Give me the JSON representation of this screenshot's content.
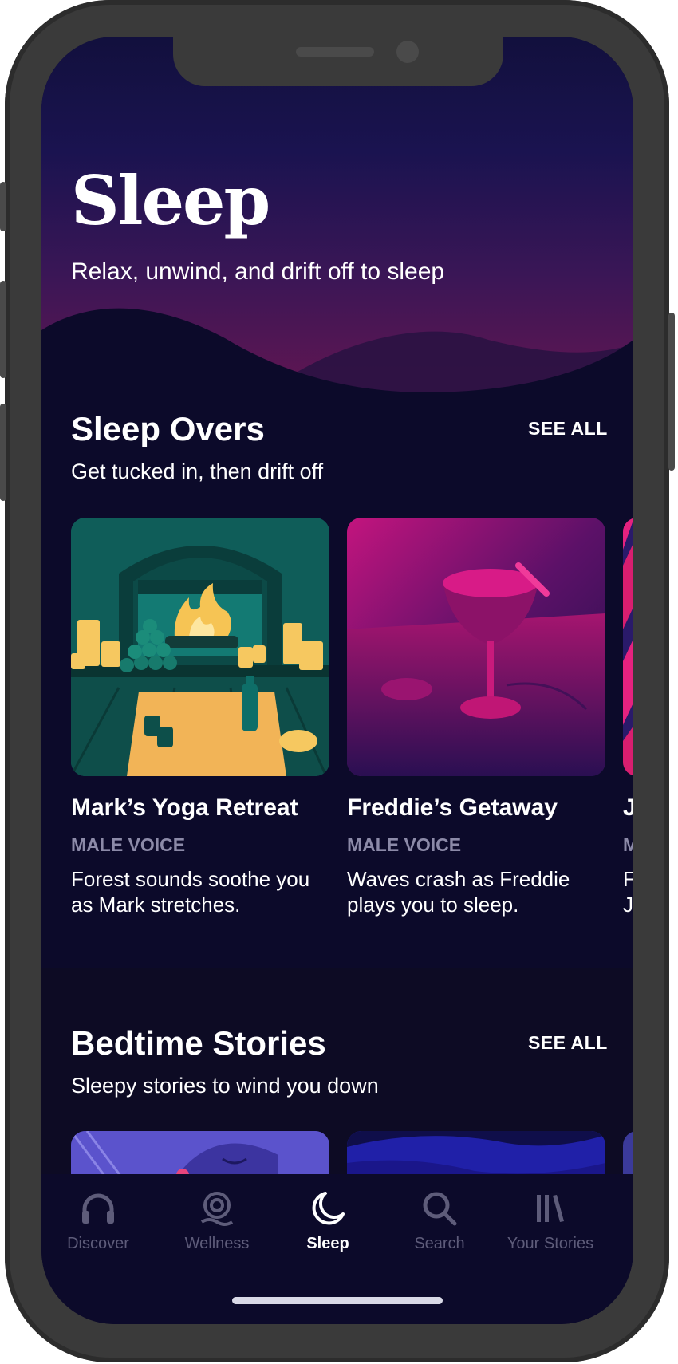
{
  "header": {
    "title": "Sleep",
    "subtitle": "Relax, unwind, and drift off to sleep"
  },
  "sections": [
    {
      "title": "Sleep Overs",
      "see_all": "SEE ALL",
      "subtitle": "Get tucked in, then drift off",
      "cards": [
        {
          "title": "Mark’s Yoga Retreat",
          "voice": "MALE VOICE",
          "description": "Forest sounds soothe you as Mark stretches."
        },
        {
          "title": "Freddie’s Getaway",
          "voice": "MALE VOICE",
          "description": "Waves crash as Freddie plays you to sleep."
        },
        {
          "title": "J",
          "voice": "M",
          "description": "F J"
        }
      ]
    },
    {
      "title": "Bedtime Stories",
      "see_all": "SEE ALL",
      "subtitle": "Sleepy stories to wind you down"
    }
  ],
  "tabbar": {
    "tabs": [
      {
        "label": "Discover",
        "icon": "headphones-icon",
        "active": false
      },
      {
        "label": "Wellness",
        "icon": "wellness-icon",
        "active": false
      },
      {
        "label": "Sleep",
        "icon": "moon-icon",
        "active": true
      },
      {
        "label": "Search",
        "icon": "search-icon",
        "active": false
      },
      {
        "label": "Your Stories",
        "icon": "library-icon",
        "active": false
      }
    ]
  },
  "colors": {
    "background": "#0c0a2a",
    "hero_top": "#12103d",
    "hero_bottom": "#6a1551",
    "muted_text": "#8c8aa8",
    "inactive_tab": "#5e5c7a",
    "phone_frame": "#3a3a3a"
  }
}
